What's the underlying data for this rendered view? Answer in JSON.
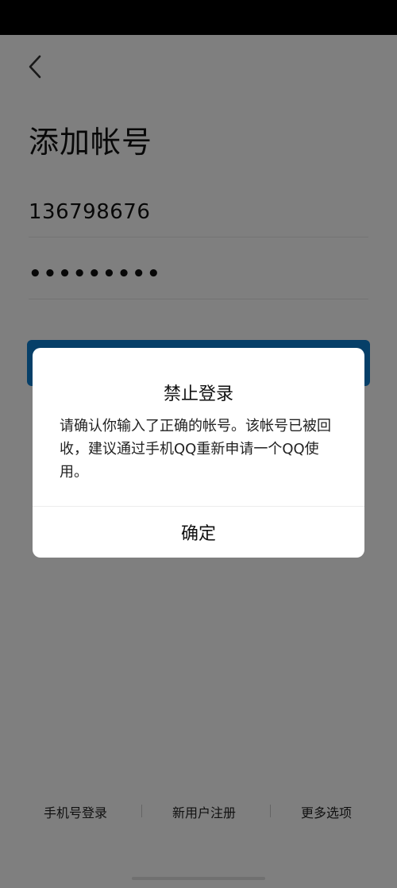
{
  "header": {
    "back_icon": "chevron-left-icon",
    "title": "添加帐号"
  },
  "form": {
    "account_value": "136798676",
    "password_value": "•••••••••"
  },
  "bottom_links": {
    "phone_login": "手机号登录",
    "register": "新用户注册",
    "more_options": "更多选项"
  },
  "dialog": {
    "title": "禁止登录",
    "message": "请确认你输入了正确的帐号。该帐号已被回收，建议通过手机QQ重新申请一个QQ使用。",
    "confirm_label": "确定"
  },
  "colors": {
    "accent": "#0d7fd0",
    "overlay": "rgba(0,0,0,0.5)"
  }
}
